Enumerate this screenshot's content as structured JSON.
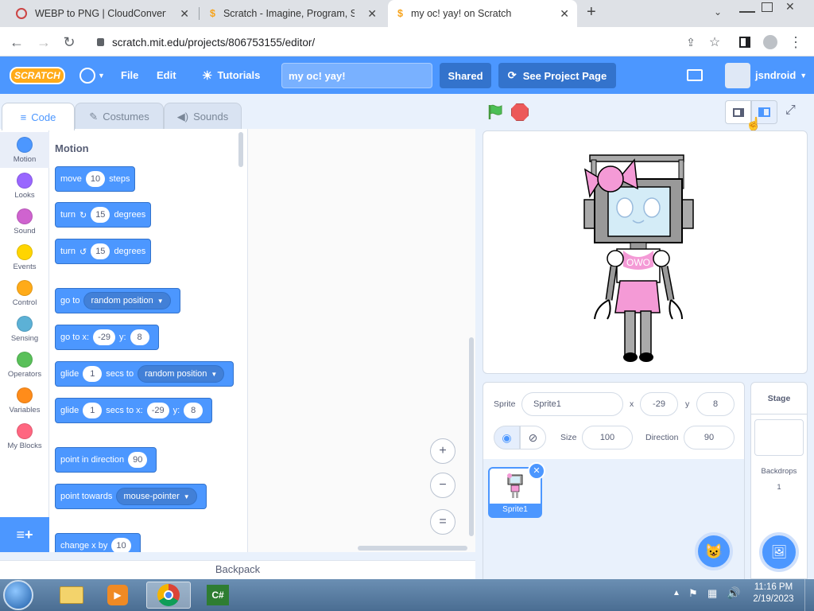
{
  "browser": {
    "tabs": [
      {
        "title": "WEBP to PNG | CloudConvert",
        "close": "✕"
      },
      {
        "title": "Scratch - Imagine, Program, Shar",
        "close": "✕"
      },
      {
        "title": "my oc! yay! on Scratch",
        "close": "✕"
      }
    ],
    "new_tab": "+",
    "url": "scratch.mit.edu/projects/806753155/editor/"
  },
  "menubar": {
    "logo": "SCRATCH",
    "file": "File",
    "edit": "Edit",
    "tutorials": "Tutorials",
    "project_title": "my oc! yay!",
    "shared": "Shared",
    "see_project_page": "See Project Page",
    "username": "jsndroid"
  },
  "editor_tabs": {
    "code": "Code",
    "costumes": "Costumes",
    "sounds": "Sounds"
  },
  "categories": [
    {
      "label": "Motion",
      "color": "#4c97ff"
    },
    {
      "label": "Looks",
      "color": "#9966ff"
    },
    {
      "label": "Sound",
      "color": "#cf63cf"
    },
    {
      "label": "Events",
      "color": "#ffd500"
    },
    {
      "label": "Control",
      "color": "#ffab19"
    },
    {
      "label": "Sensing",
      "color": "#5cb1d6"
    },
    {
      "label": "Operators",
      "color": "#59c059"
    },
    {
      "label": "Variables",
      "color": "#ff8c1a"
    },
    {
      "label": "My Blocks",
      "color": "#ff6680"
    }
  ],
  "palette": {
    "heading": "Motion",
    "move": {
      "a": "move",
      "v": "10",
      "b": "steps"
    },
    "turn_right": {
      "a": "turn",
      "v": "15",
      "b": "degrees"
    },
    "turn_left": {
      "a": "turn",
      "v": "15",
      "b": "degrees"
    },
    "goto": {
      "a": "go to",
      "dd": "random position"
    },
    "gotoxy": {
      "a": "go to x:",
      "x": "-29",
      "b": "y:",
      "y": "8"
    },
    "glide_to": {
      "a": "glide",
      "v": "1",
      "b": "secs to",
      "dd": "random position"
    },
    "glide_xy": {
      "a": "glide",
      "v": "1",
      "b": "secs to x:",
      "x": "-29",
      "c": "y:",
      "y": "8"
    },
    "point_dir": {
      "a": "point in direction",
      "v": "90"
    },
    "point_towards": {
      "a": "point towards",
      "dd": "mouse-pointer"
    },
    "change_x": {
      "a": "change x by",
      "v": "10"
    }
  },
  "zoom": {
    "zoom_in": "+",
    "zoom_out": "−",
    "reset": "="
  },
  "backpack": "Backpack",
  "stage_stage_text": "OWO",
  "sprite_info": {
    "sprite_label": "Sprite",
    "sprite_name": "Sprite1",
    "x_label": "x",
    "x": "-29",
    "y_label": "y",
    "y": "8",
    "size_label": "Size",
    "size": "100",
    "direction_label": "Direction",
    "direction": "90"
  },
  "sprite_tile": "Sprite1",
  "stage_panel": {
    "title": "Stage",
    "backdrops_label": "Backdrops",
    "backdrops_count": "1"
  },
  "taskbar": {
    "time": "11:16 PM",
    "date": "2/19/2023"
  }
}
